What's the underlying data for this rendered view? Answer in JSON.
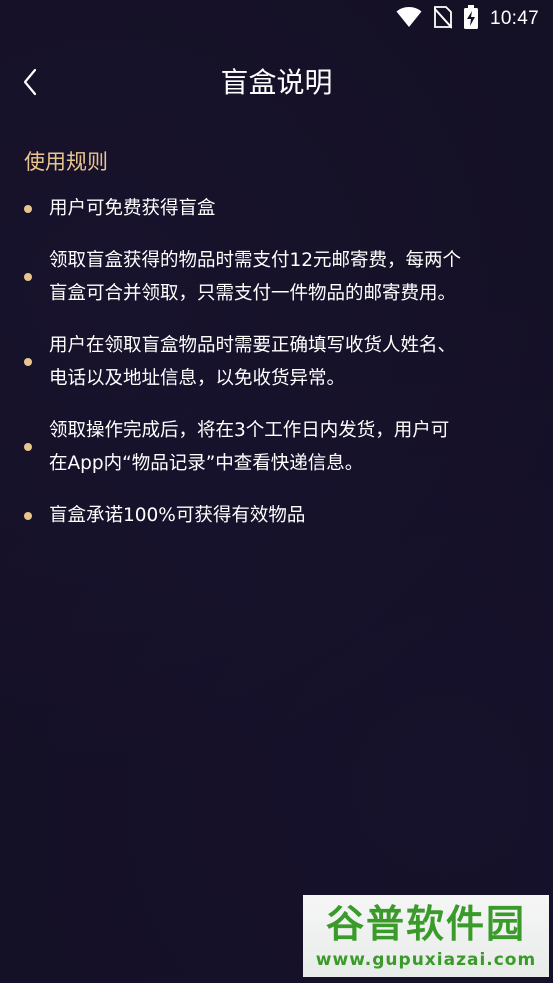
{
  "status_bar": {
    "time": "10:47",
    "icons": [
      "wifi-icon",
      "no-sim-icon",
      "battery-charging-icon"
    ]
  },
  "nav": {
    "title": "盲盒说明",
    "back_icon": "chevron-left-icon"
  },
  "section": {
    "title": "使用规则"
  },
  "rules": [
    {
      "lines": [
        "用户可免费获得盲盒"
      ]
    },
    {
      "lines": [
        "领取盲盒获得的物品时需支付12元邮寄费，每两个",
        "盲盒可合并领取，只需支付一件物品的邮寄费用。"
      ]
    },
    {
      "lines": [
        "用户在领取盲盒物品时需要正确填写收货人姓名、",
        "电话以及地址信息，以免收货异常。"
      ]
    },
    {
      "lines": [
        "领取操作完成后，将在3个工作日内发货，用户可",
        "在App内“物品记录”中查看快递信息。"
      ]
    },
    {
      "lines": [
        "盲盒承诺100%可获得有效物品"
      ]
    }
  ],
  "watermark": {
    "logo": "谷普软件园",
    "url": "www.gupuxiazai.com"
  },
  "colors": {
    "background": "#141025",
    "accent_gold": "#e9c58e",
    "text": "#ffffff",
    "watermark_green": "#3a9a2a"
  }
}
